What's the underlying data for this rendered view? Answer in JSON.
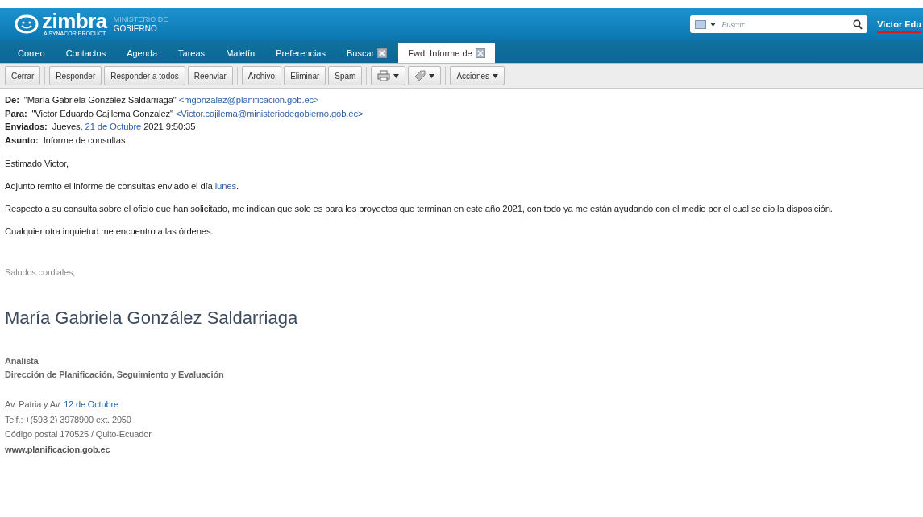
{
  "header": {
    "logo": {
      "brand": "zimbra",
      "tagline": "A SYNACOR PRODUCT",
      "org_top": "MINISTERIO DE",
      "org": "GOBIERNO"
    },
    "search": {
      "placeholder": "Buscar"
    },
    "user": "Victor Edu"
  },
  "tabs": [
    {
      "label": "Correo",
      "selected": false,
      "closable": false
    },
    {
      "label": "Contactos",
      "selected": false,
      "closable": false
    },
    {
      "label": "Agenda",
      "selected": false,
      "closable": false
    },
    {
      "label": "Tareas",
      "selected": false,
      "closable": false
    },
    {
      "label": "Maletín",
      "selected": false,
      "closable": false
    },
    {
      "label": "Preferencias",
      "selected": false,
      "closable": false
    },
    {
      "label": "Buscar",
      "selected": false,
      "closable": true
    },
    {
      "label": "Fwd: Informe de",
      "selected": true,
      "closable": true
    }
  ],
  "toolbar": [
    [
      {
        "kind": "text",
        "label": "Cerrar"
      }
    ],
    [
      {
        "kind": "text",
        "label": "Responder"
      },
      {
        "kind": "text",
        "label": "Responder a todos"
      },
      {
        "kind": "text",
        "label": "Reenviar"
      }
    ],
    [
      {
        "kind": "text",
        "label": "Archivo"
      },
      {
        "kind": "text",
        "label": "Eliminar"
      },
      {
        "kind": "text",
        "label": "Spam"
      }
    ],
    [
      {
        "kind": "print"
      },
      {
        "kind": "tag"
      }
    ],
    [
      {
        "kind": "menu",
        "label": "Acciones"
      }
    ]
  ],
  "message": {
    "headers": [
      {
        "label": "De:",
        "parts": [
          {
            "text": "\"María Gabriela González Saldarriaga\"",
            "link": false
          },
          {
            "text": "<mgonzalez@planificacion.gob.ec>",
            "link": true
          }
        ]
      },
      {
        "label": "Para:",
        "parts": [
          {
            "text": "\"Victor Eduardo Cajilema Gonzalez\"",
            "link": false
          },
          {
            "text": "<Victor.cajilema@ministeriodegobierno.gob.ec>",
            "link": true
          }
        ]
      },
      {
        "label": "Enviados:",
        "parts": [
          {
            "text": "Jueves,",
            "link": false
          },
          {
            "text": "21 de Octubre",
            "link": true
          },
          {
            "text": "2021 9:50:35",
            "link": false
          }
        ]
      },
      {
        "label": "Asunto:",
        "parts": [
          {
            "text": "Informe de consultas",
            "link": false
          }
        ]
      }
    ],
    "paragraphs": [
      [
        {
          "text": "Estimado Victor,",
          "link": false
        }
      ],
      [
        {
          "text": "Adjunto remito el informe de consultas enviado el día",
          "link": false
        },
        {
          "text": "lunes",
          "link": true
        },
        {
          "text": ".",
          "link": false
        }
      ],
      [
        {
          "text": "Respecto a su consulta sobre el oficio que han solicitado, me indican que solo es para los proyectos que terminan en este año 2021, con todo ya me están ayudando con el medio por el cual se dio la disposición.",
          "link": false
        }
      ],
      [
        {
          "text": "Cualquier otra inquietud me encuentro a las órdenes.",
          "link": false
        }
      ]
    ],
    "signature": {
      "greeting": "Saludos cordiales,",
      "name": "María Gabriela González Saldarriaga",
      "title": "Analista",
      "department": "Dirección de Planificación, Seguimiento y Evaluación",
      "lines": [
        [
          {
            "text": "Av. Patria y Av.",
            "link": false
          },
          {
            "text": "12 de Octubre",
            "link": true
          }
        ],
        [
          {
            "text": "Telf.: +(593 2) 3978900 ext. 2050",
            "link": false
          }
        ],
        [
          {
            "text": "Código postal 170525 / Quito-Ecuador.",
            "link": false
          }
        ]
      ],
      "website": "www.planificacion.gob.ec"
    }
  }
}
